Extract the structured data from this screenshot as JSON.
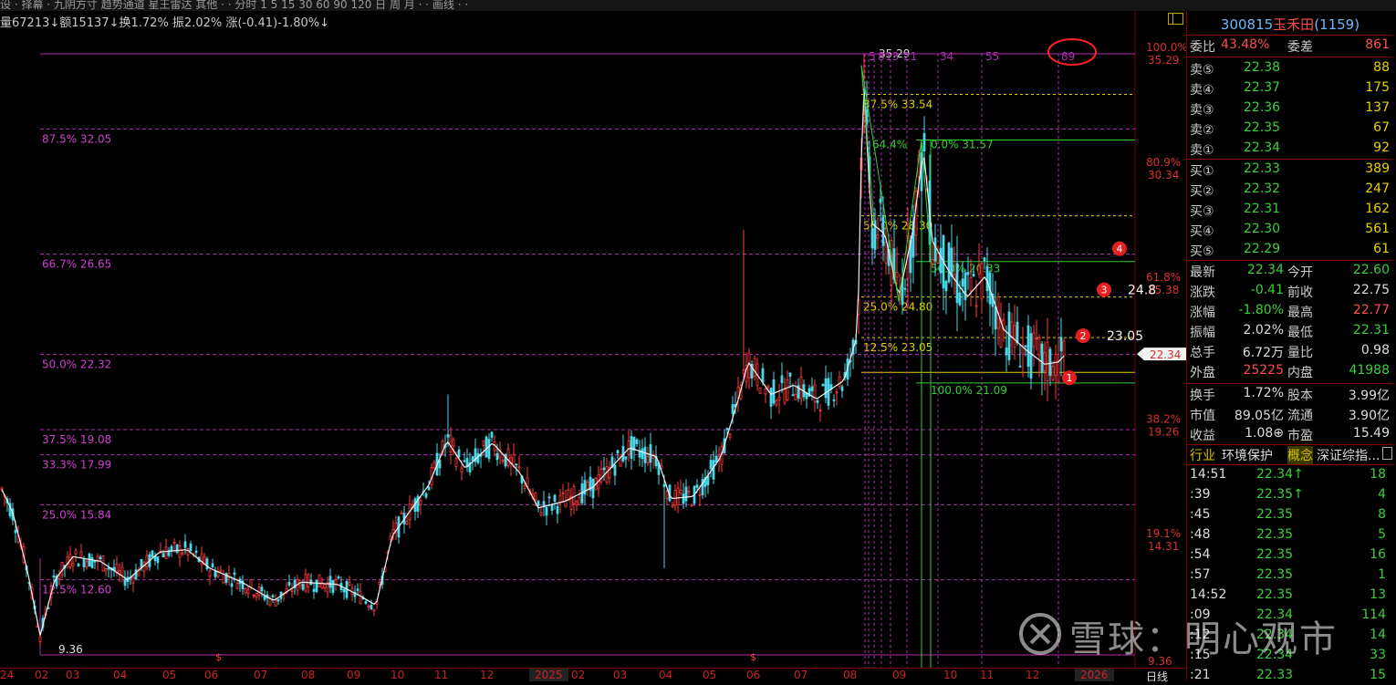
{
  "topbar": {
    "text": "设 · 择幕 · 九阴方寸 趋势通道 星王雷达 其他 · · 分时 1 5 15 30 60 90 120 日 周 月 · · 画线 · ·"
  },
  "info_bar": {
    "text": "量67213↓额15137↓换1.72% 振2.02% 涨(-0.41)-1.80%↓"
  },
  "chart_data": {
    "type": "candlestick",
    "price_range": [
      9.36,
      35.29
    ],
    "x_axis": [
      "24",
      "02",
      "03",
      "04",
      "05",
      "06",
      "07",
      "08",
      "09",
      "10",
      "11",
      "12",
      "2025",
      "02",
      "03",
      "04",
      "05",
      "06",
      "07",
      "08",
      "09",
      "10",
      "11",
      "12",
      "2026"
    ],
    "x_axis_right": "日线",
    "low_label": "9.36",
    "high_label": "35.29",
    "fib_left": [
      {
        "label": "87.5% 32.05",
        "price": 32.05
      },
      {
        "label": "66.7% 26.65",
        "price": 26.65
      },
      {
        "label": "50.0% 22.32",
        "price": 22.32
      },
      {
        "label": "37.5% 19.08",
        "price": 19.08
      },
      {
        "label": "33.3% 17.99",
        "price": 17.99
      },
      {
        "label": "25.0% 15.84",
        "price": 15.84
      },
      {
        "label": "12.5% 12.60",
        "price": 12.6
      }
    ],
    "fib_yellow": [
      {
        "label": "87.5% 33.54",
        "price": 33.54
      },
      {
        "label": "50.0% 28.30",
        "price": 28.3
      },
      {
        "label": "25.0% 24.80",
        "price": 24.8
      },
      {
        "label": "12.5% 23.05",
        "price": 23.05
      }
    ],
    "fib_green": [
      {
        "label": "0.0% 31.57",
        "price": 31.57
      },
      {
        "label": "50.0% 26.33",
        "price": 26.33
      },
      {
        "label": "100.0% 21.09",
        "price": 21.09
      }
    ],
    "green_top_label": "64.4%",
    "cycle_labels": [
      "3",
      "5",
      "8",
      "13",
      "21",
      "34",
      "55",
      "89"
    ],
    "right_axis": [
      {
        "pct": "100.0%",
        "price": "35.29"
      },
      {
        "pct": "80.9%",
        "price": "30.34"
      },
      {
        "pct": "61.8%",
        "price": "25.38"
      },
      {
        "pct": "38.2%",
        "price": "19.26"
      },
      {
        "pct": "19.1%",
        "price": "14.31"
      },
      {
        "pct": "",
        "price": "9.36"
      }
    ],
    "current_price": "22.34",
    "annotations": [
      {
        "num": "1",
        "price": 21.55
      },
      {
        "num": "2",
        "price": 23.05,
        "text": "23.05"
      },
      {
        "num": "3",
        "price": 24.8,
        "text": "24.8"
      },
      {
        "num": "4",
        "price": 26.65
      }
    ]
  },
  "quote": {
    "code": "300815",
    "name": "玉禾田",
    "count": "(1159)",
    "weibi_label": "委比",
    "weibi": "43.48%",
    "weicha_label": "委差",
    "weicha": "861",
    "asks": [
      {
        "label": "卖⑤",
        "price": "22.38",
        "vol": "88"
      },
      {
        "label": "卖④",
        "price": "22.37",
        "vol": "175"
      },
      {
        "label": "卖③",
        "price": "22.36",
        "vol": "137"
      },
      {
        "label": "卖②",
        "price": "22.35",
        "vol": "67"
      },
      {
        "label": "卖①",
        "price": "22.34",
        "vol": "92"
      }
    ],
    "bids": [
      {
        "label": "买①",
        "price": "22.33",
        "vol": "389"
      },
      {
        "label": "买②",
        "price": "22.32",
        "vol": "247"
      },
      {
        "label": "买③",
        "price": "22.31",
        "vol": "162"
      },
      {
        "label": "买④",
        "price": "22.30",
        "vol": "561"
      },
      {
        "label": "买⑤",
        "price": "22.29",
        "vol": "61"
      }
    ],
    "stats": [
      [
        "最新",
        "22.34",
        "今开",
        "22.60"
      ],
      [
        "涨跌",
        "-0.41",
        "前收",
        "22.75"
      ],
      [
        "涨幅",
        "-1.80%",
        "最高",
        "22.77"
      ],
      [
        "振幅",
        "2.02%",
        "最低",
        "22.31"
      ],
      [
        "总手",
        "6.72万",
        "量比",
        "0.98"
      ],
      [
        "外盘",
        "25225",
        "内盘",
        "41988"
      ]
    ],
    "stats2": [
      [
        "换手",
        "1.72%",
        "股本",
        "3.99亿"
      ],
      [
        "市值",
        "89.05亿",
        "流通",
        "3.90亿"
      ],
      [
        "收益",
        "1.08⊕",
        "市盈",
        "15.49"
      ]
    ],
    "industry_label": "行业",
    "industry": "环境保护",
    "concept_label": "概念",
    "concept": "深证综指..."
  },
  "ticks": [
    {
      "time": "14:51",
      "price": "22.34↑",
      "vol": "18"
    },
    {
      "time": ":39",
      "price": "22.35↑",
      "vol": "4"
    },
    {
      "time": ":45",
      "price": "22.35",
      "vol": "8"
    },
    {
      "time": ":48",
      "price": "22.35",
      "vol": "5"
    },
    {
      "time": ":54",
      "price": "22.35",
      "vol": "16"
    },
    {
      "time": ":57",
      "price": "22.35",
      "vol": "1"
    },
    {
      "time": "14:52",
      "price": "22.35",
      "vol": "13"
    },
    {
      "time": ":09",
      "price": "22.34",
      "vol": "114"
    },
    {
      "time": ":12",
      "price": "22.34",
      "vol": "14"
    },
    {
      "time": ":15",
      "price": "22.34",
      "vol": "33"
    },
    {
      "time": ":21",
      "price": "22.33",
      "vol": "15"
    }
  ],
  "watermark": {
    "text": "雪球：明心观市"
  }
}
